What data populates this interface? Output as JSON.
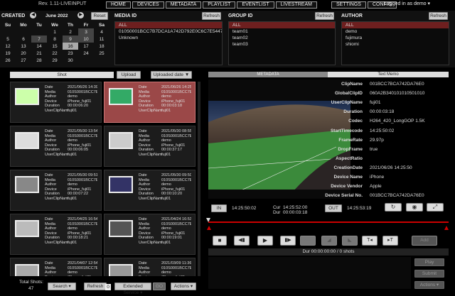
{
  "app": {
    "version": "Rev. 1.11-LIVEINPUT",
    "logged_in": "Logged in as demo ▾"
  },
  "nav": [
    "HOME",
    "DEVICES",
    "METADATA",
    "PLAYLIST",
    "EVENTLIST",
    "LIVESTREAM",
    "SETTINGS",
    "CONFIG"
  ],
  "created": {
    "label": "CREATED",
    "month": "June 2022",
    "reset": "Reset",
    "days": [
      "Su",
      "Mo",
      "Tu",
      "We",
      "Th",
      "Fr",
      "Sa"
    ],
    "weeks": [
      [
        "",
        "",
        "",
        "1",
        "2",
        "3",
        "4"
      ],
      [
        "5",
        "6",
        "7",
        "8",
        "9",
        "10",
        "11"
      ],
      [
        "12",
        "13",
        "14",
        "15",
        "16",
        "17",
        "18"
      ],
      [
        "19",
        "20",
        "21",
        "22",
        "23",
        "24",
        "25"
      ],
      [
        "26",
        "27",
        "28",
        "29",
        "30",
        "",
        ""
      ]
    ]
  },
  "media_id": {
    "label": "MEDIA ID",
    "refresh": "Refresh",
    "items": [
      "ALL",
      "010S0001BCC7B7DCA1A742D792E0C6C7E5447986",
      "Unknown"
    ]
  },
  "group_id": {
    "label": "GROUP ID",
    "refresh": "Refresh",
    "items": [
      "ALL",
      "team01",
      "team02",
      "team03"
    ]
  },
  "author": {
    "label": "AUTHOR",
    "refresh": "Refresh",
    "items": [
      "ALL",
      "demo",
      "fujimura",
      "shiomi"
    ]
  },
  "shot": {
    "tab": "Shot",
    "upload": "Upload",
    "sort": "Uploaded date ▼"
  },
  "card_keys": [
    "Date",
    "Media",
    "Author",
    "Device",
    "Duration",
    "UserClipNam"
  ],
  "cards": [
    [
      "2021/06/26 14:39",
      "010S0001BCC7E",
      "demo",
      "iPhone_fuji01",
      "00:00:06:20",
      "fuji01"
    ],
    [
      "2021/06/26 14:25",
      "010S0001BCC7E",
      "demo",
      "iPhone_fuji01",
      "00:00:03:18",
      "fuji01"
    ],
    [
      "2021/05/30 13:54",
      "010S0001BCC7E",
      "demo",
      "iPhone_fuji01",
      "00:00:06:05",
      "fuji01"
    ],
    [
      "2021/05/30 08:55",
      "010S0001BCC7E",
      "demo",
      "iPhone_fuji01",
      "00:00:37:17",
      "fuji01"
    ],
    [
      "2021/05/30 09:51",
      "010S0001BCC7E",
      "demo",
      "iPhone_fuji01",
      "00:00:07:22",
      "fuji01"
    ],
    [
      "2021/05/30 09:50",
      "010S0001BCC7E",
      "demo",
      "iPhone_fuji01",
      "00:00:10:20",
      "fuji01"
    ],
    [
      "2021/04/25 16:54",
      "010S0001BCC7E",
      "demo",
      "iPhone_fuji01",
      "00:00:18:21",
      "fuji01"
    ],
    [
      "2021/04/24 16:53",
      "010S0001BCC7E",
      "demo",
      "iPhone_fuji01",
      "00:00:19:01",
      "fuji01"
    ],
    [
      "2021/04/07 12:54",
      "010S0001BCC7E",
      "demo",
      "iPhone_fuji01",
      "00:00:05:02",
      "fuji01"
    ],
    [
      "2021/03/09 11:36",
      "010S0001BCC7E",
      "demo",
      "iPhone_fuji01",
      "00:00:04:04",
      "fuji01"
    ]
  ],
  "tabs": {
    "metadata": "METADATA",
    "text_memo": "Text Memo"
  },
  "metadata": [
    [
      "ClipName",
      "001BCC7BCA742DA76E0"
    ],
    [
      "GlobalClipID",
      "060A2B340101010501010"
    ],
    [
      "UserClipName",
      "fuji01"
    ],
    [
      "Duration",
      "00:00:03:18"
    ],
    [
      "Codec",
      "H264_420_LongGOP 1.5K"
    ],
    [
      "StartTimecode",
      "14:25:50:02"
    ],
    [
      "FrameRate",
      "29.97p"
    ],
    [
      "DropFrame",
      "true"
    ],
    [
      "AspectRatio",
      ""
    ],
    [
      "CreationDate",
      "2021/06/26 14:25:50"
    ],
    [
      "Device Name",
      "iPhone"
    ],
    [
      "Device Vendor",
      "Apple"
    ],
    [
      "Device Serial No.",
      "001BCC7BCA742DA76E0"
    ]
  ],
  "player": {
    "in": "IN",
    "in_tc": "14:25:50:02",
    "cur_label": "Cur",
    "cur": "14:25:52:00",
    "dur_label": "Dur",
    "dur": "00:00:03:18",
    "out": "OUT",
    "out_tc": "14:25:53:19",
    "total_dur": "Dur 00:00:00:00 / 0 shots",
    "add": "Add"
  },
  "right_actions": {
    "play": "Play",
    "submit": "Submit",
    "actions": "Actions ▾"
  },
  "footer": {
    "total_label": "Total Shots:",
    "total": "47",
    "search": "Search ▾",
    "refresh": "Refresh",
    "refresh_count": "0",
    "extended": "Extended Service ▾",
    "go": "GO",
    "actions": "Actions ▾"
  }
}
